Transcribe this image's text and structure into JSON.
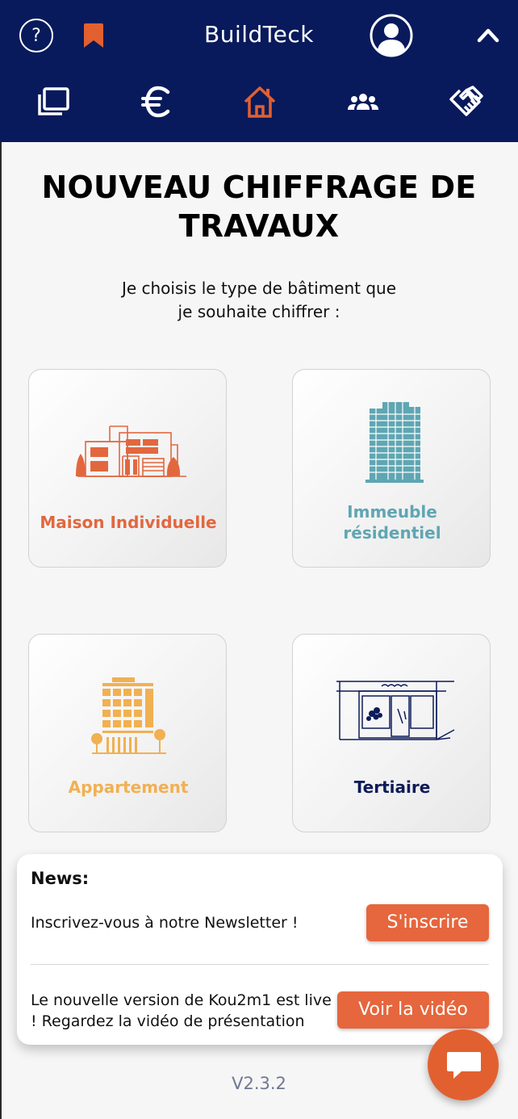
{
  "header": {
    "app_title": "BuildTeck",
    "help_label": "?",
    "icons": [
      "help-icon",
      "bookmark-icon",
      "user-avatar-icon",
      "chevron-up-icon"
    ]
  },
  "nav": {
    "items": [
      {
        "name": "projects",
        "icon": "folders-icon",
        "active": false
      },
      {
        "name": "pricing",
        "icon": "euro-icon",
        "active": false
      },
      {
        "name": "home",
        "icon": "home-icon",
        "active": true
      },
      {
        "name": "team",
        "icon": "users-icon",
        "active": false
      },
      {
        "name": "partners",
        "icon": "handshake-icon",
        "active": false
      }
    ]
  },
  "main": {
    "title_line1": "NOUVEAU CHIFFRAGE DE",
    "title_line2": "TRAVAUX",
    "subtitle_line1": "Je choisis le type de bâtiment que",
    "subtitle_line2": "je souhaite chiffrer :"
  },
  "building_types": [
    {
      "label": "Maison Individuelle",
      "color": "#e2673f",
      "icon": "house-icon"
    },
    {
      "label_line1": "Immeuble",
      "label_line2": "résidentiel",
      "color": "#5fa6b3",
      "icon": "residential-building-icon"
    },
    {
      "label": "Appartement",
      "color": "#f1b052",
      "icon": "apartment-building-icon"
    },
    {
      "label": "Tertiaire",
      "color": "#0d1b58",
      "icon": "storefront-icon"
    }
  ],
  "news": {
    "heading": "News:",
    "newsletter_text": "Inscrivez-vous à notre Newsletter !",
    "subscribe_label": "S'inscrire",
    "video_text_line1": "Le nouvelle version de Kou2m1 est live",
    "video_text_line2": "! Regardez la vidéo de présentation",
    "video_label": "Voir la vidéo"
  },
  "version": "V2.3.2",
  "colors": {
    "header_bg": "#081a5c",
    "accent": "#e6663d",
    "page_bg": "#f6f6f6"
  }
}
